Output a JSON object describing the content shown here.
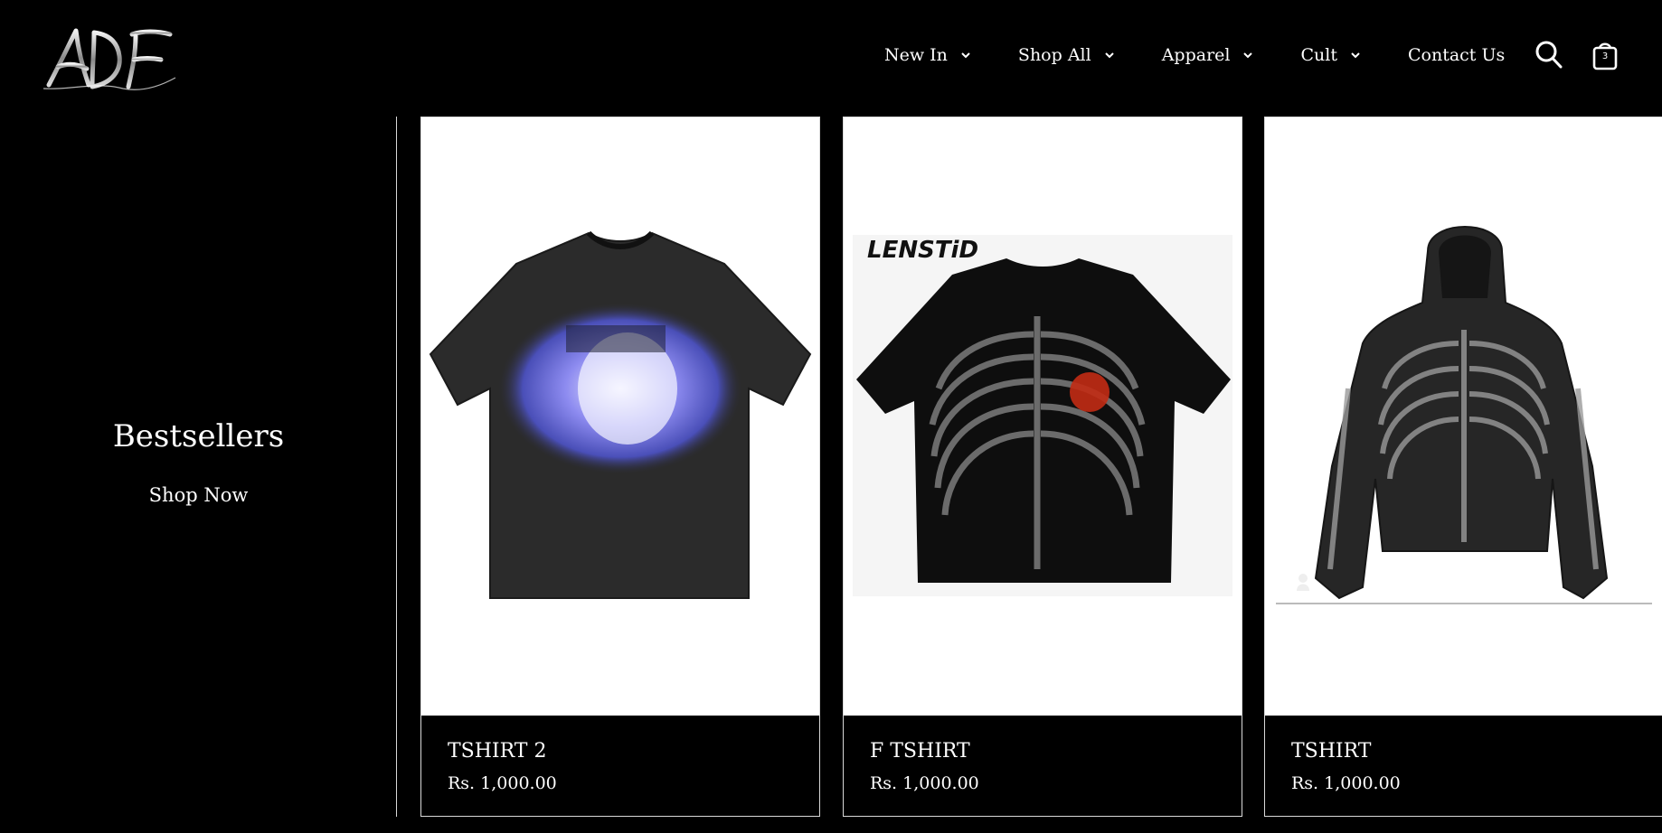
{
  "header": {
    "logo_text": "ADF",
    "nav": [
      {
        "label": "New In",
        "has_dropdown": true
      },
      {
        "label": "Shop All",
        "has_dropdown": true
      },
      {
        "label": "Apparel",
        "has_dropdown": true
      },
      {
        "label": "Cult",
        "has_dropdown": true
      },
      {
        "label": "Contact Us",
        "has_dropdown": false
      }
    ],
    "search_icon": "search-icon",
    "cart_icon": "shopping-bag-icon",
    "cart_count": "3"
  },
  "promo": {
    "title": "Bestsellers",
    "link_label": "Shop Now"
  },
  "products": [
    {
      "name": "TSHIRT 2",
      "price": "Rs. 1,000.00",
      "image": "black tshirt with blurred blue face print"
    },
    {
      "name": "F TSHIRT",
      "price": "Rs. 1,000.00",
      "image": "black tshirt with x-ray ribcage print",
      "image_brand": "LENSTiD"
    },
    {
      "name": "TSHIRT",
      "price": "Rs. 1,000.00",
      "image": "black hoodie with skeleton x-ray print"
    }
  ],
  "colors": {
    "background": "#000000",
    "text": "#ffffff",
    "border": "#d9d9d9",
    "image_bg": "#ffffff"
  }
}
